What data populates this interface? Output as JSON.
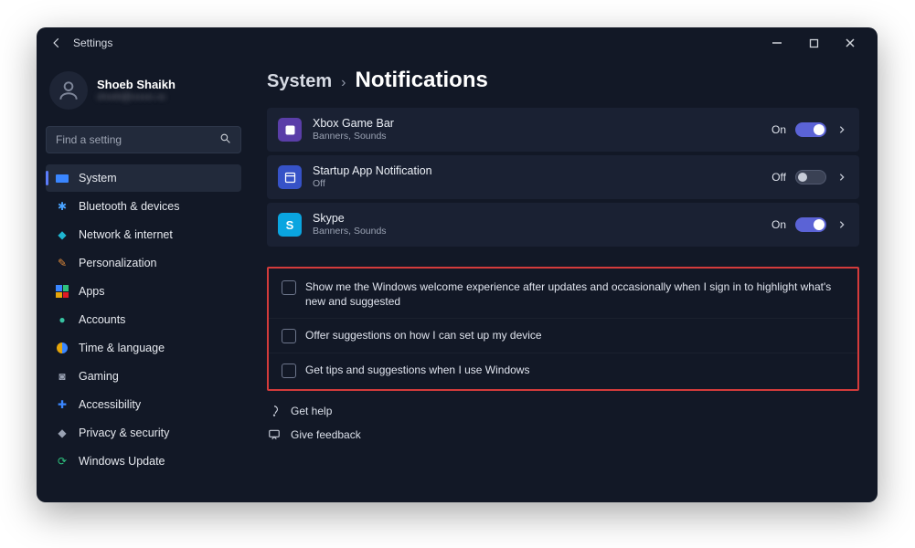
{
  "window": {
    "title": "Settings"
  },
  "profile": {
    "name": "Shoeb Shaikh",
    "email_obscured": "shoeb@xxxxx.xx"
  },
  "search": {
    "placeholder": "Find a setting"
  },
  "nav": {
    "items": [
      {
        "label": "System",
        "selected": true
      },
      {
        "label": "Bluetooth & devices"
      },
      {
        "label": "Network & internet"
      },
      {
        "label": "Personalization"
      },
      {
        "label": "Apps"
      },
      {
        "label": "Accounts"
      },
      {
        "label": "Time & language"
      },
      {
        "label": "Gaming"
      },
      {
        "label": "Accessibility"
      },
      {
        "label": "Privacy & security"
      },
      {
        "label": "Windows Update"
      }
    ]
  },
  "breadcrumb": {
    "parent": "System",
    "separator": "›",
    "current": "Notifications"
  },
  "app_rows": [
    {
      "title": "Xbox Game Bar",
      "sub": "Banners, Sounds",
      "state_label": "On",
      "on": true
    },
    {
      "title": "Startup App Notification",
      "sub": "Off",
      "state_label": "Off",
      "on": false
    },
    {
      "title": "Skype",
      "sub": "Banners, Sounds",
      "state_label": "On",
      "on": true
    }
  ],
  "checkboxes": [
    {
      "label": "Show me the Windows welcome experience after updates and occasionally when I sign in to highlight what's new and suggested",
      "checked": false
    },
    {
      "label": "Offer suggestions on how I can set up my device",
      "checked": false
    },
    {
      "label": "Get tips and suggestions when I use Windows",
      "checked": false
    }
  ],
  "footer": {
    "help": "Get help",
    "feedback": "Give feedback"
  }
}
